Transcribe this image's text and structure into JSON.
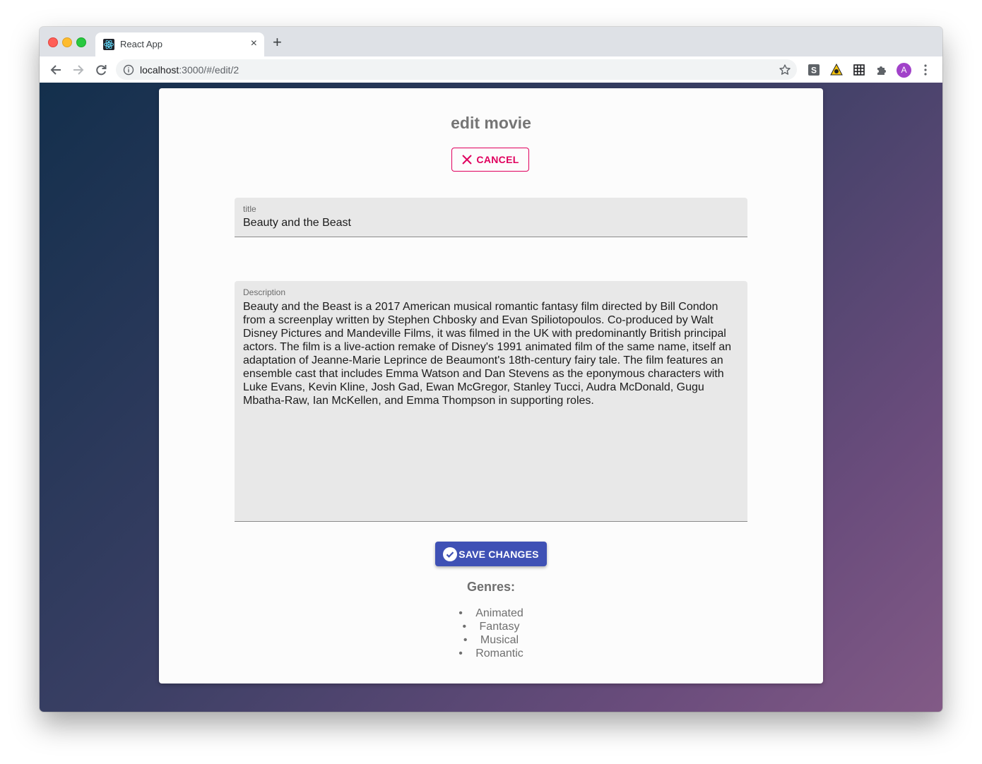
{
  "browser": {
    "tab_title": "React App",
    "tab_close": "×",
    "new_tab": "+",
    "url_host": "localhost",
    "url_rest": ":3000/#/edit/2",
    "avatar_initial": "A"
  },
  "page": {
    "title": "edit movie",
    "cancel_label": "CANCEL",
    "title_field": {
      "label": "title",
      "value": "Beauty and the Beast"
    },
    "description_field": {
      "label": "Description",
      "value": "Beauty and the Beast is a 2017 American musical romantic fantasy film directed by Bill Condon from a screenplay written by Stephen Chbosky and Evan Spiliotopoulos. Co-produced by Walt Disney Pictures and Mandeville Films, it was filmed in the UK with predominantly British principal actors. The film is a live-action remake of Disney's 1991 animated film of the same name, itself an adaptation of Jeanne-Marie Leprince de Beaumont's 18th-century fairy tale. The film features an ensemble cast that includes Emma Watson and Dan Stevens as the eponymous characters with Luke Evans, Kevin Kline, Josh Gad, Ewan McGregor, Stanley Tucci, Audra McDonald, Gugu Mbatha-Raw, Ian McKellen, and Emma Thompson in supporting roles."
    },
    "save_label": "SAVE CHANGES",
    "genres_title": "Genres:",
    "genres": [
      "Animated",
      "Fantasy",
      "Musical",
      "Romantic"
    ]
  },
  "colors": {
    "accent_secondary": "#e0005e",
    "accent_primary": "#3f51b5"
  },
  "icons": [
    "react-favicon",
    "back-arrow-icon",
    "forward-arrow-icon",
    "reload-icon",
    "info-icon",
    "star-icon",
    "extension-s-icon",
    "extension-warning-icon",
    "extension-grid-icon",
    "puzzle-icon",
    "kebab-menu-icon",
    "close-x-icon",
    "check-circle-icon"
  ]
}
